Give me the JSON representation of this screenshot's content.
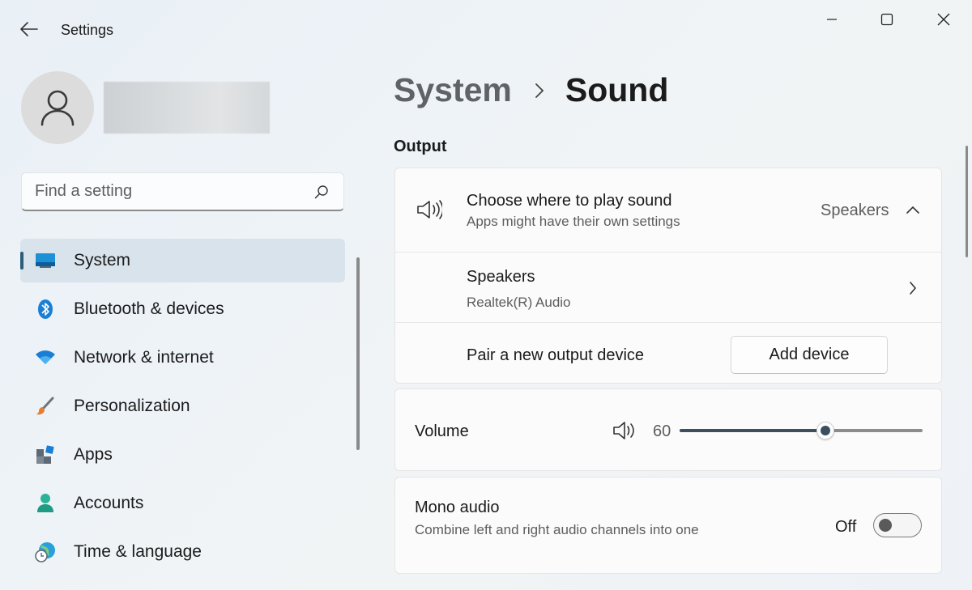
{
  "window": {
    "title": "Settings"
  },
  "search": {
    "placeholder": "Find a setting"
  },
  "sidebar": {
    "items": [
      {
        "label": "System",
        "icon": "system-icon",
        "active": true
      },
      {
        "label": "Bluetooth & devices",
        "icon": "bluetooth-icon"
      },
      {
        "label": "Network & internet",
        "icon": "wifi-icon"
      },
      {
        "label": "Personalization",
        "icon": "paintbrush-icon"
      },
      {
        "label": "Apps",
        "icon": "apps-icon"
      },
      {
        "label": "Accounts",
        "icon": "accounts-icon"
      },
      {
        "label": "Time & language",
        "icon": "globe-clock-icon"
      }
    ]
  },
  "breadcrumb": {
    "parent": "System",
    "current": "Sound"
  },
  "output": {
    "section_title": "Output",
    "choose": {
      "title": "Choose where to play sound",
      "subtitle": "Apps might have their own settings",
      "value": "Speakers"
    },
    "device": {
      "name": "Speakers",
      "detail": "Realtek(R) Audio"
    },
    "pair": {
      "label": "Pair a new output device",
      "button": "Add device"
    }
  },
  "volume": {
    "label": "Volume",
    "value": "60",
    "level": 0.6
  },
  "mono": {
    "title": "Mono audio",
    "subtitle": "Combine left and right audio channels into one",
    "state": "Off"
  },
  "colors": {
    "accent": "#3a4f60",
    "active_indicator": "#2b5c7a"
  }
}
